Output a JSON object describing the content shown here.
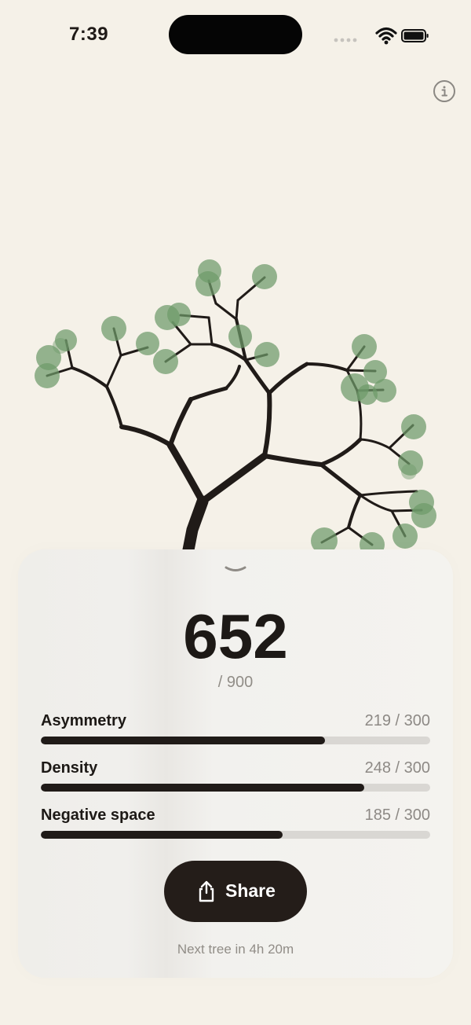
{
  "status_bar": {
    "time": "7:39",
    "icons": [
      "cellular-dots-icon",
      "wifi-icon",
      "battery-icon"
    ]
  },
  "header": {
    "info_icon": "info-icon"
  },
  "colors": {
    "background": "#f5f1e8",
    "trunk": "#201b18",
    "leaf": "#6e9a6a",
    "button": "#241d19",
    "track": "#d9d7d3"
  },
  "panel": {
    "collapse_icon": "chevron-down-icon",
    "score": "652",
    "score_max": "/ 900",
    "metrics": [
      {
        "label": "Asymmetry",
        "value": "219 / 300",
        "progress": 0.73
      },
      {
        "label": "Density",
        "value": "248 / 300",
        "progress": 0.83
      },
      {
        "label": "Negative space",
        "value": "185 / 300",
        "progress": 0.62
      }
    ],
    "share_label": "Share",
    "share_icon": "share-icon",
    "next_tree": "Next tree in 4h 20m"
  }
}
